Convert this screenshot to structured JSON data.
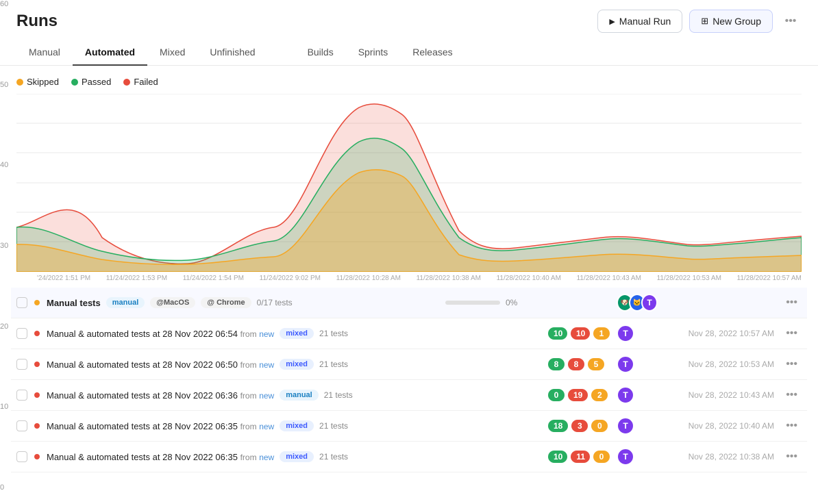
{
  "page": {
    "title": "Runs"
  },
  "actions": {
    "manual_run": "Manual Run",
    "new_group": "New Group",
    "more": "..."
  },
  "tabs": [
    {
      "id": "manual",
      "label": "Manual",
      "active": false
    },
    {
      "id": "automated",
      "label": "Automated",
      "active": true
    },
    {
      "id": "mixed",
      "label": "Mixed",
      "active": false
    },
    {
      "id": "unfinished",
      "label": "Unfinished",
      "active": false
    },
    {
      "id": "builds",
      "label": "Builds",
      "active": false
    },
    {
      "id": "sprints",
      "label": "Sprints",
      "active": false
    },
    {
      "id": "releases",
      "label": "Releases",
      "active": false
    }
  ],
  "legend": [
    {
      "label": "Skipped",
      "color": "#f5a623"
    },
    {
      "label": "Passed",
      "color": "#27ae60"
    },
    {
      "label": "Failed",
      "color": "#e74c3c"
    }
  ],
  "chart": {
    "yLabels": [
      "60",
      "50",
      "40",
      "30",
      "20",
      "10",
      "0"
    ],
    "xLabels": [
      "'24/2022 1:51 PM",
      "11/24/2022 1:53 PM",
      "11/24/2022 1:54 PM",
      "11/24/2022 9:02 PM",
      "11/28/2022 10:28 AM",
      "11/28/2022 10:38 AM",
      "11/28/2022 10:40 AM",
      "11/28/2022 10:43 AM",
      "11/28/2022 10:53 AM",
      "11/28/2022 10:57 AM"
    ]
  },
  "runs": [
    {
      "id": "group",
      "title": "Manual tests",
      "badge": "manual",
      "badges": [
        "@MacOS",
        "@ Chrome"
      ],
      "tests": "0/17 tests",
      "progress": 0,
      "counts": [],
      "time": "",
      "isGroup": true
    },
    {
      "id": "r1",
      "title": "Manual & automated tests at 28 Nov 2022 06:54",
      "from": "from",
      "fromNew": "new",
      "badge": "mixed",
      "tests": "21 tests",
      "progress": null,
      "counts": [
        {
          "val": "10",
          "type": "green"
        },
        {
          "val": "10",
          "type": "red"
        },
        {
          "val": "1",
          "type": "orange"
        }
      ],
      "time": "Nov 28, 2022 10:57 AM"
    },
    {
      "id": "r2",
      "title": "Manual & automated tests at 28 Nov 2022 06:50",
      "from": "from",
      "fromNew": "new",
      "badge": "mixed",
      "tests": "21 tests",
      "progress": null,
      "counts": [
        {
          "val": "8",
          "type": "green"
        },
        {
          "val": "8",
          "type": "red"
        },
        {
          "val": "5",
          "type": "orange"
        }
      ],
      "time": "Nov 28, 2022 10:53 AM"
    },
    {
      "id": "r3",
      "title": "Manual & automated tests at 28 Nov 2022 06:36",
      "from": "from",
      "fromNew": "new",
      "badge": "manual",
      "tests": "21 tests",
      "progress": null,
      "counts": [
        {
          "val": "0",
          "type": "green"
        },
        {
          "val": "19",
          "type": "red"
        },
        {
          "val": "2",
          "type": "orange"
        }
      ],
      "time": "Nov 28, 2022 10:43 AM"
    },
    {
      "id": "r4",
      "title": "Manual & automated tests at 28 Nov 2022 06:35",
      "from": "from",
      "fromNew": "new",
      "badge": "mixed",
      "tests": "21 tests",
      "progress": null,
      "counts": [
        {
          "val": "18",
          "type": "green"
        },
        {
          "val": "3",
          "type": "red"
        },
        {
          "val": "0",
          "type": "orange"
        }
      ],
      "time": "Nov 28, 2022 10:40 AM"
    },
    {
      "id": "r5",
      "title": "Manual & automated tests at 28 Nov 2022 06:35",
      "from": "from",
      "fromNew": "new",
      "badge": "mixed",
      "tests": "21 tests",
      "progress": null,
      "counts": [
        {
          "val": "10",
          "type": "green"
        },
        {
          "val": "11",
          "type": "red"
        },
        {
          "val": "0",
          "type": "orange"
        }
      ],
      "time": "Nov 28, 2022 10:38 AM"
    }
  ]
}
